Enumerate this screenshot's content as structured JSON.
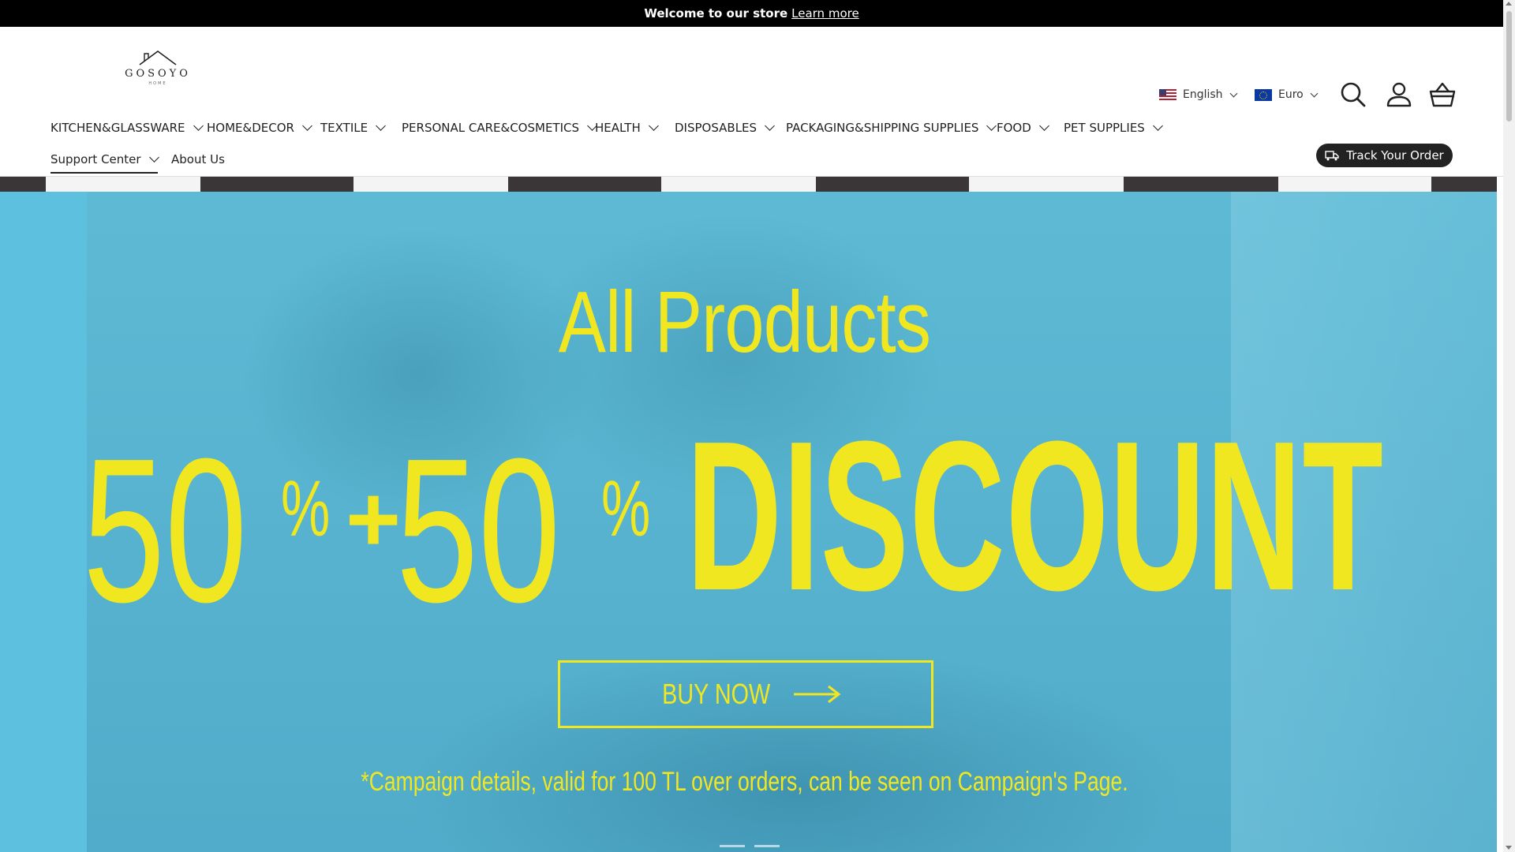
{
  "announcement": {
    "text": "Welcome to our store",
    "link": "Learn more"
  },
  "brand": {
    "name": "GOSOYO",
    "tagline": "HOME"
  },
  "locale": {
    "language": "English",
    "currency": "Euro"
  },
  "icons": {
    "search": "search-icon",
    "account": "account-icon",
    "cart": "basket-icon",
    "truck": "truck-icon"
  },
  "nav": {
    "items": [
      "KITCHEN&GLASSWARE",
      "HOME&DECOR",
      "TEXTILE",
      "PERSONAL CARE&COSMETICS",
      "HEALTH",
      "DISPOSABLES",
      "PACKAGING&SHIPPING SUPPLIES",
      "FOOD",
      "PET SUPPLIES"
    ],
    "support": "Support Center",
    "about": "About Us"
  },
  "track_order": "Track Your Order",
  "hero": {
    "title": "All Products",
    "num1": "50",
    "pct1": "%",
    "plus": "+",
    "num2": "50",
    "pct2": "%",
    "discount": "DISCOUNT",
    "button": "BUY NOW",
    "campaign": "*Campaign details, valid for 100 TL over orders, can be seen on Campaign's Page."
  },
  "colors": {
    "accent": "#f0e721",
    "hero_bg": "#63c2df",
    "dark": "#222222"
  }
}
